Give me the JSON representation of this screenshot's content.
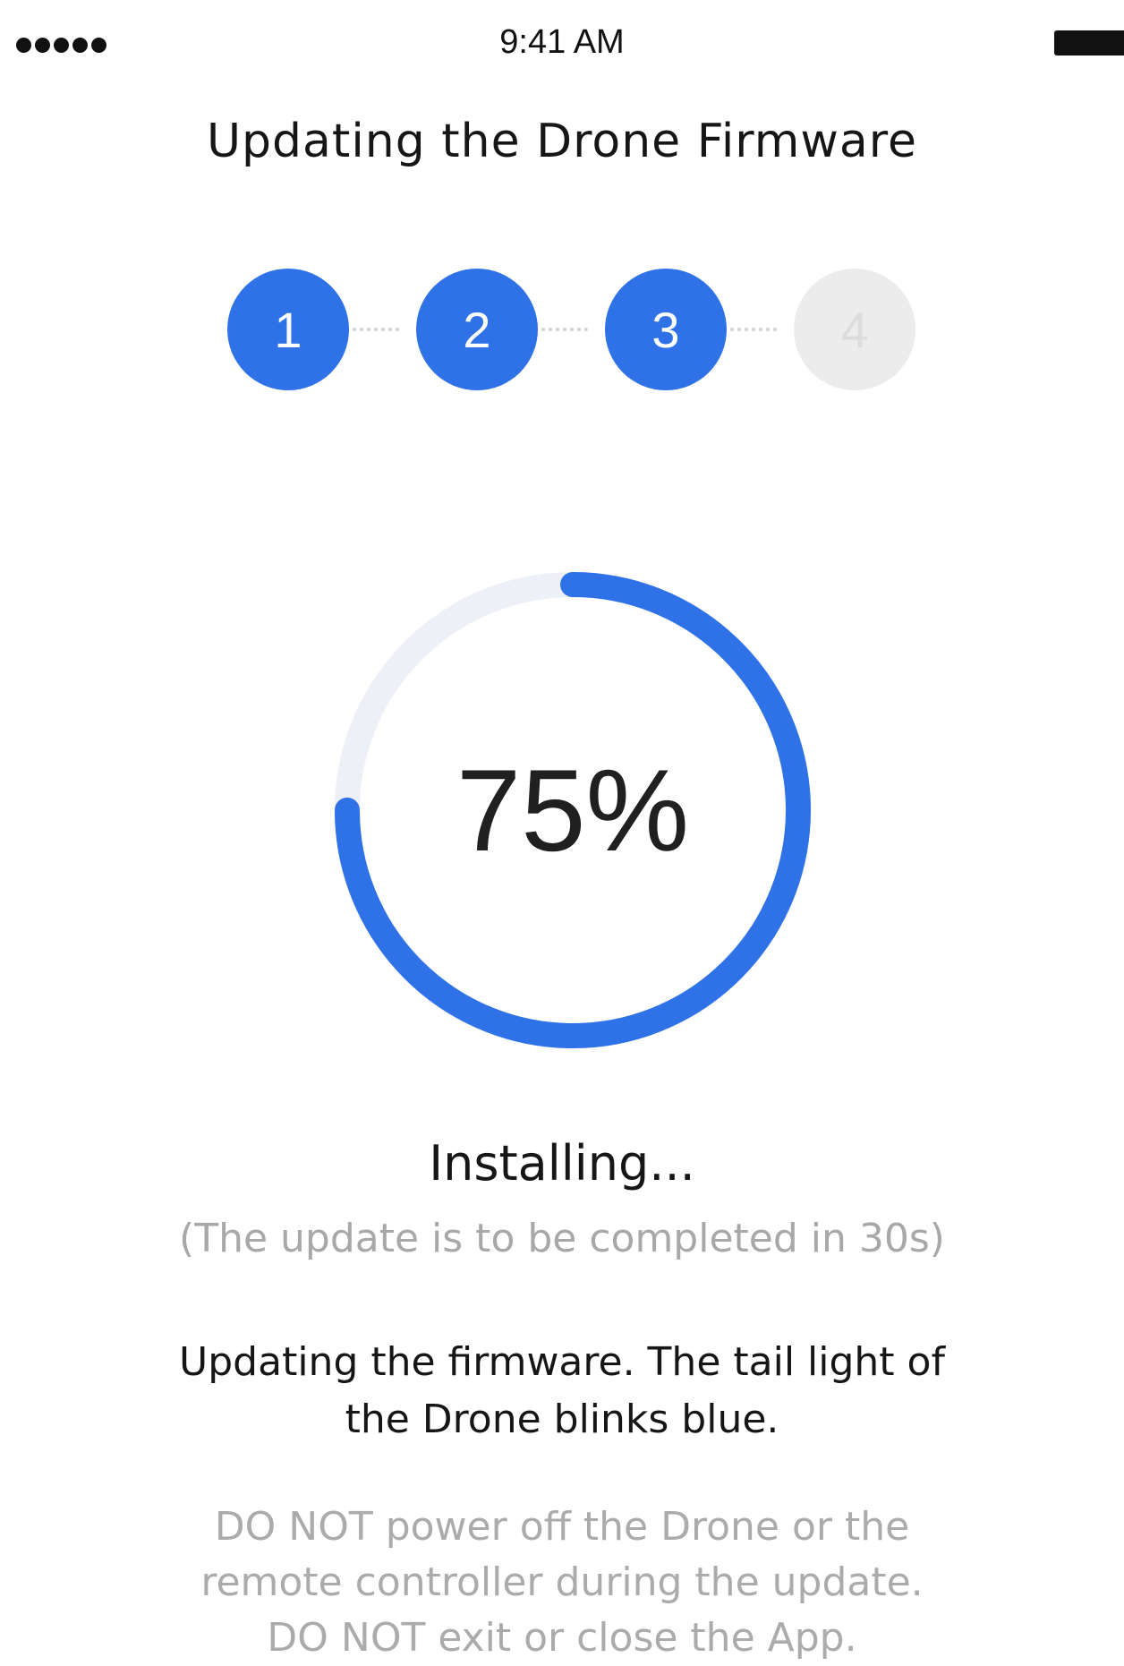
{
  "status_bar": {
    "time": "9:41 AM",
    "signal_icon": "signal-dots-icon",
    "battery_icon": "battery-icon"
  },
  "header": {
    "title": "Updating the Drone Firmware"
  },
  "steps": [
    {
      "label": "1",
      "state": "done"
    },
    {
      "label": "2",
      "state": "done"
    },
    {
      "label": "3",
      "state": "active"
    },
    {
      "label": "4",
      "state": "pending"
    }
  ],
  "progress": {
    "percent_text": "75%",
    "value": 0.75
  },
  "status": {
    "heading": "Installing...",
    "eta": "(The update is to be completed in 30s)"
  },
  "message": {
    "description": "Updating the firmware. The tail light of the Drone blinks blue.",
    "warning_line1": "DO NOT power off the Drone or the",
    "warning_line2": "remote controller during the update.",
    "warning_line3": "DO NOT exit or close the App."
  },
  "colors": {
    "accent": "#2f72e8",
    "ring_track": "#eef0f7",
    "inactive_step": "#ececec",
    "muted_text": "#a8a8a8"
  }
}
